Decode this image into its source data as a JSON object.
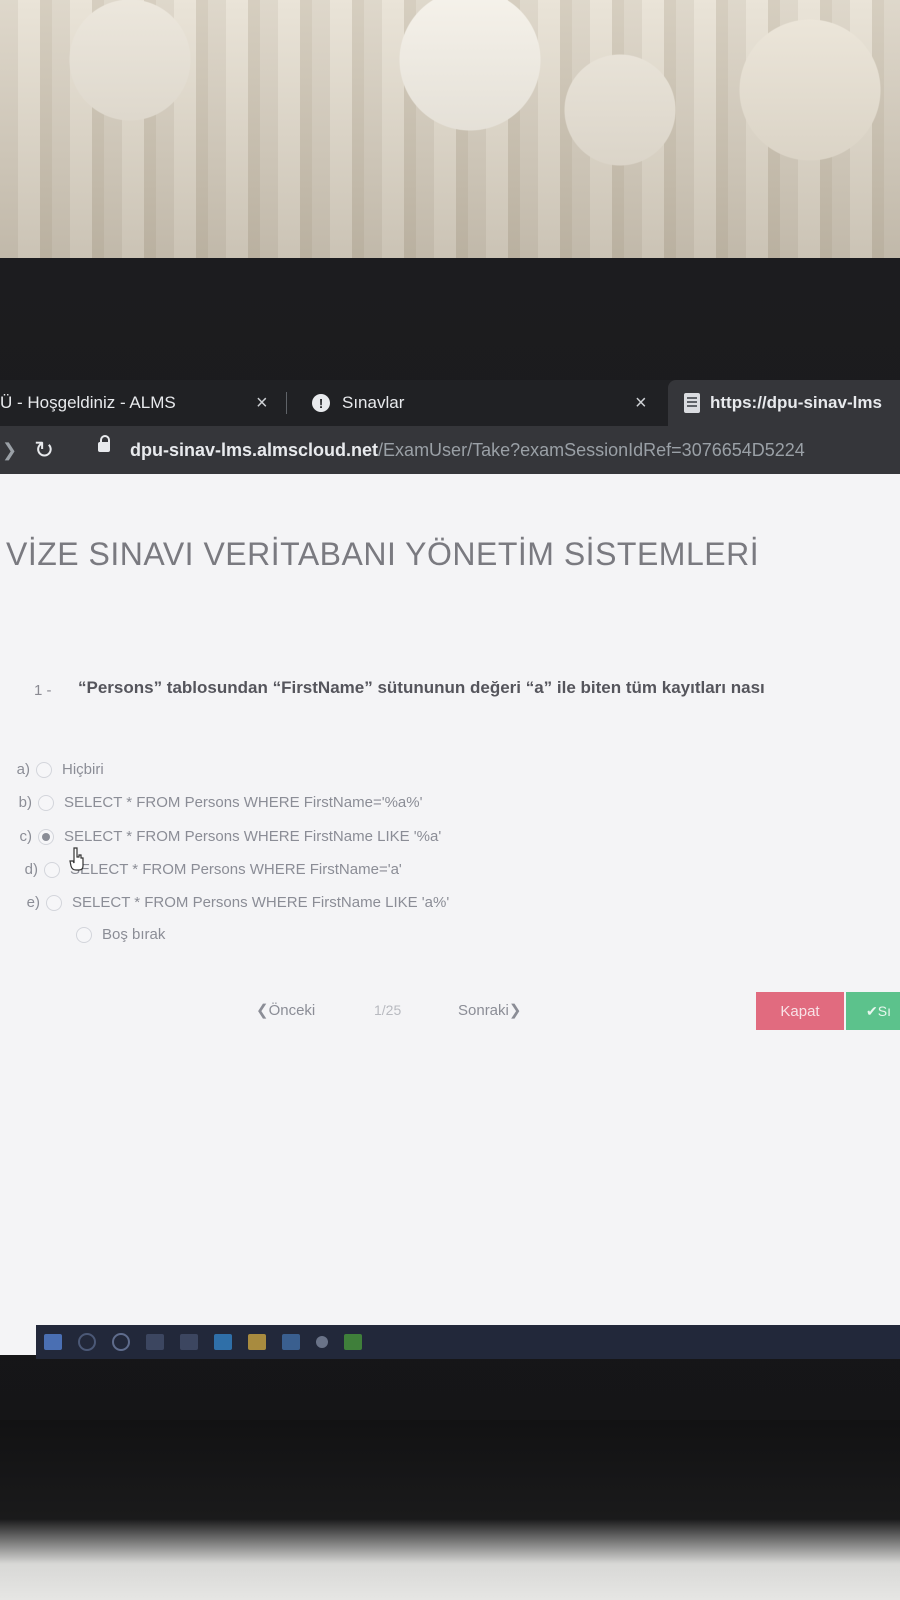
{
  "browser": {
    "tabs": [
      {
        "title": "Ü - Hoşgeldiniz - ALMS",
        "close": "×"
      },
      {
        "title": "Sınavlar",
        "close": "×"
      },
      {
        "title": "https://dpu-sinav-lms"
      }
    ],
    "address": {
      "host": "dpu-sinav-lms.almscloud.net",
      "path": "/ExamUser/Take?examSessionIdRef=3076654D5224"
    }
  },
  "exam": {
    "title": "VİZE SINAVI VERİTABANI YÖNETİM SİSTEMLERİ",
    "question": {
      "number": "1 -",
      "text": "“Persons” tablosundan “FirstName” sütununun değeri “a” ile biten tüm kayıtları nası"
    },
    "options": [
      {
        "letter": "a)",
        "text": "Hiçbiri",
        "checked": false
      },
      {
        "letter": "b)",
        "text": "SELECT * FROM Persons WHERE FirstName='%a%'",
        "checked": false
      },
      {
        "letter": "c)",
        "text": "SELECT * FROM Persons WHERE FirstName LIKE '%a'",
        "checked": true
      },
      {
        "letter": "d)",
        "text": "SELECT * FROM Persons WHERE FirstName='a'",
        "checked": false
      },
      {
        "letter": "e)",
        "text": "SELECT * FROM Persons WHERE FirstName LIKE 'a%'",
        "checked": false
      },
      {
        "letter": "",
        "text": "Boş bırak",
        "checked": false
      }
    ],
    "pager": {
      "prev": "❮Önceki",
      "count": "1/25",
      "next": "Sonraki❯"
    },
    "buttons": {
      "close": "Kapat",
      "submit": "✔Sı"
    }
  },
  "colors": {
    "close_button": "#e16b7f",
    "submit_button": "#5cc28c",
    "browser_dark": "#202124"
  }
}
